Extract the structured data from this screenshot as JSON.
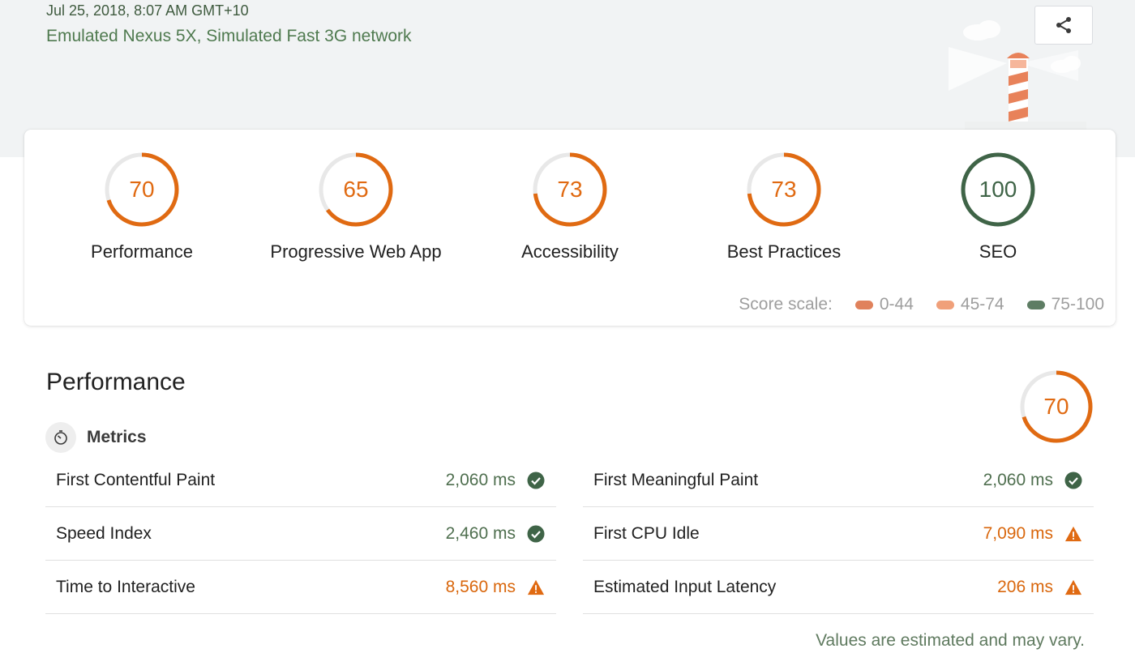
{
  "header": {
    "date": "Jul 25, 2018, 8:07 AM GMT+10",
    "environment": "Emulated Nexus 5X, Simulated Fast 3G network",
    "share_icon": "share-icon"
  },
  "categories": [
    {
      "label": "Performance",
      "score": "70",
      "score_value": 70,
      "color": "#e06a12"
    },
    {
      "label": "Progressive Web App",
      "score": "65",
      "score_value": 65,
      "color": "#e06a12"
    },
    {
      "label": "Accessibility",
      "score": "73",
      "score_value": 73,
      "color": "#e06a12"
    },
    {
      "label": "Best Practices",
      "score": "73",
      "score_value": 73,
      "color": "#e06a12"
    },
    {
      "label": "SEO",
      "score": "100",
      "score_value": 100,
      "color": "#3f6447"
    }
  ],
  "score_scale": {
    "label": "Score scale:",
    "ranges": [
      {
        "label": "0-44",
        "color": "#e0825c"
      },
      {
        "label": "45-74",
        "color": "#f0a07a"
      },
      {
        "label": "75-100",
        "color": "#5e7d64"
      }
    ]
  },
  "performance": {
    "title": "Performance",
    "score": "70",
    "score_value": 70,
    "metrics_label": "Metrics",
    "metrics_icon": "stopwatch-icon",
    "metrics_left": [
      {
        "name": "First Contentful Paint",
        "value": "2,060 ms",
        "status": "pass"
      },
      {
        "name": "Speed Index",
        "value": "2,460 ms",
        "status": "pass"
      },
      {
        "name": "Time to Interactive",
        "value": "8,560 ms",
        "status": "warn"
      }
    ],
    "metrics_right": [
      {
        "name": "First Meaningful Paint",
        "value": "2,060 ms",
        "status": "pass"
      },
      {
        "name": "First CPU Idle",
        "value": "7,090 ms",
        "status": "warn"
      },
      {
        "name": "Estimated Input Latency",
        "value": "206 ms",
        "status": "warn"
      }
    ],
    "disclaimer": "Values are estimated and may vary."
  },
  "colors": {
    "pass": "#3f6447",
    "average": "#e06a12",
    "track": "#e8e8e8"
  }
}
